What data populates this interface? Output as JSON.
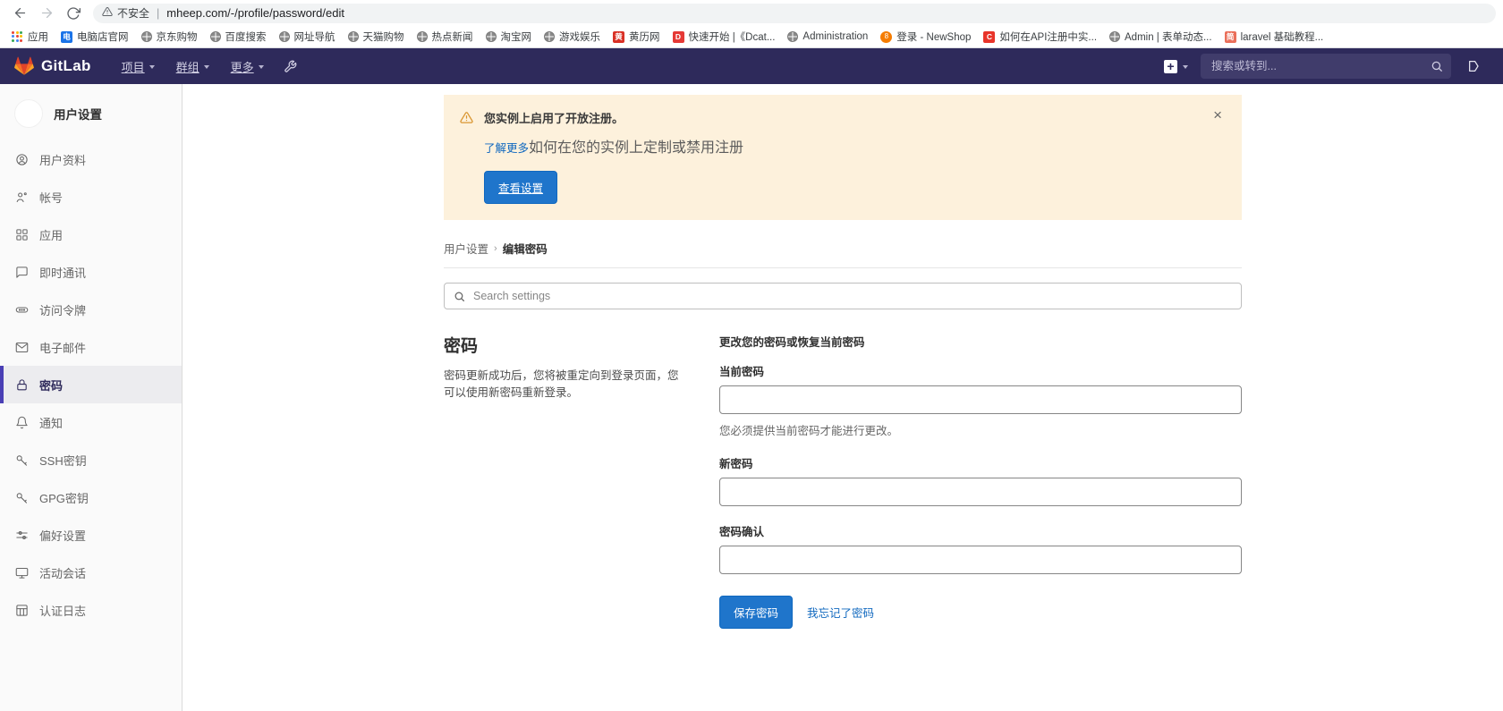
{
  "browser": {
    "back_icon": "back-arrow-icon",
    "forward_icon": "forward-arrow-icon",
    "reload_icon": "reload-icon",
    "security_warning": "不安全",
    "url": "mheep.com/-/profile/password/edit",
    "bookmarks": [
      {
        "label": "应用",
        "icon": "apps-grid-icon",
        "icon_type": "apps"
      },
      {
        "label": "电脑店官网",
        "icon": "site-icon-dianshop",
        "icon_type": "sq",
        "glyph": "电",
        "bg": "#1a73e8"
      },
      {
        "label": "京东购物",
        "icon": "globe-icon",
        "icon_type": "globe"
      },
      {
        "label": "百度搜索",
        "icon": "globe-icon",
        "icon_type": "globe"
      },
      {
        "label": "网址导航",
        "icon": "globe-icon",
        "icon_type": "globe"
      },
      {
        "label": "天猫购物",
        "icon": "globe-icon",
        "icon_type": "globe"
      },
      {
        "label": "热点新闻",
        "icon": "globe-icon",
        "icon_type": "globe"
      },
      {
        "label": "淘宝网",
        "icon": "globe-icon",
        "icon_type": "globe"
      },
      {
        "label": "游戏娱乐",
        "icon": "globe-icon",
        "icon_type": "globe"
      },
      {
        "label": "黄历网",
        "icon": "site-icon-huangli",
        "icon_type": "sq",
        "glyph": "黄",
        "bg": "#d93025"
      },
      {
        "label": "快速开始 |《Dcat...",
        "icon": "site-icon-dcat",
        "icon_type": "sq",
        "glyph": "D",
        "bg": "#e53935"
      },
      {
        "label": "Administration",
        "icon": "globe-icon",
        "icon_type": "globe"
      },
      {
        "label": "登录 - NewShop",
        "icon": "site-icon-newshop",
        "icon_type": "circle",
        "glyph": "8",
        "bg": "#f57c00"
      },
      {
        "label": "如何在API注册中实...",
        "icon": "site-icon-csdn",
        "icon_type": "sq",
        "glyph": "C",
        "bg": "#e8342a"
      },
      {
        "label": "Admin | 表单动态...",
        "icon": "globe-icon",
        "icon_type": "globe"
      },
      {
        "label": "laravel 基础教程...",
        "icon": "site-icon-jianshu",
        "icon_type": "sq",
        "glyph": "简",
        "bg": "#ea6f5a"
      }
    ]
  },
  "navbar": {
    "brand": "GitLab",
    "links": [
      {
        "label": "项目",
        "name": "nav-projects"
      },
      {
        "label": "群组",
        "name": "nav-groups"
      },
      {
        "label": "更多",
        "name": "nav-more"
      }
    ],
    "wrench_icon": "wrench-icon",
    "plus_icon": "plus-icon",
    "search_placeholder": "搜索或转到...",
    "search_value": "",
    "search_icon": "search-icon",
    "merge_requests_icon": "merge-request-icon"
  },
  "sidebar": {
    "title": "用户设置",
    "avatar": "user-avatar",
    "items": [
      {
        "label": "用户资料",
        "icon": "profile-circle-icon",
        "active": false
      },
      {
        "label": "帐号",
        "icon": "account-gear-icon",
        "active": false
      },
      {
        "label": "应用",
        "icon": "applications-grid-icon",
        "active": false
      },
      {
        "label": "即时通讯",
        "icon": "chat-bubble-icon",
        "active": false
      },
      {
        "label": "访问令牌",
        "icon": "token-pill-icon",
        "active": false
      },
      {
        "label": "电子邮件",
        "icon": "envelope-icon",
        "active": false
      },
      {
        "label": "密码",
        "icon": "lock-icon",
        "active": true
      },
      {
        "label": "通知",
        "icon": "bell-icon",
        "active": false
      },
      {
        "label": "SSH密钥",
        "icon": "key-icon",
        "active": false
      },
      {
        "label": "GPG密钥",
        "icon": "key-icon",
        "active": false
      },
      {
        "label": "偏好设置",
        "icon": "sliders-icon",
        "active": false
      },
      {
        "label": "活动会话",
        "icon": "monitor-icon",
        "active": false
      },
      {
        "label": "认证日志",
        "icon": "log-list-icon",
        "active": false
      }
    ]
  },
  "alert": {
    "warning_icon": "warning-triangle-icon",
    "title": "您实例上启用了开放注册。",
    "link_text": "了解更多",
    "link_rest": "如何在您的实例上定制或禁用注册",
    "button_label": "查看设置",
    "close_icon": "close-icon"
  },
  "breadcrumb": {
    "parent": "用户设置",
    "separator": "›",
    "current": "编辑密码"
  },
  "settings_search": {
    "placeholder": "Search settings",
    "value": "",
    "icon": "search-icon"
  },
  "password_section": {
    "heading": "密码",
    "description": "密码更新成功后，您将被重定向到登录页面，您可以使用新密码重新登录。",
    "form_heading": "更改您的密码或恢复当前密码",
    "fields": [
      {
        "label": "当前密码",
        "value": "",
        "help": "您必须提供当前密码才能进行更改。",
        "name": "current-password-field"
      },
      {
        "label": "新密码",
        "value": "",
        "help": "",
        "name": "new-password-field"
      },
      {
        "label": "密码确认",
        "value": "",
        "help": "",
        "name": "confirm-password-field"
      }
    ],
    "submit_label": "保存密码",
    "forgot_label": "我忘记了密码"
  },
  "colors": {
    "gitlab_navy": "#2e2a5b",
    "accent_blue": "#1f75cb",
    "alert_bg": "#fdf1dc",
    "sidebar_bg": "#fafafa",
    "active_indicator": "#4a3fb5"
  }
}
